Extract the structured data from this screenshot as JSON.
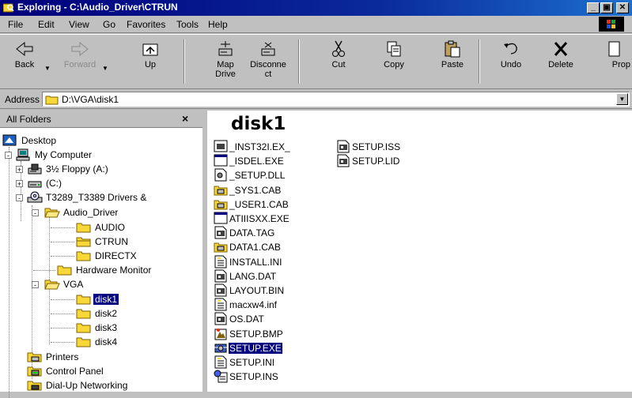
{
  "window": {
    "title": "Exploring - C:\\Audio_Driver\\CTRUN",
    "buttons": [
      "_",
      "🗗",
      "✕"
    ]
  },
  "menu": [
    "File",
    "Edit",
    "View",
    "Go",
    "Favorites",
    "Tools",
    "Help"
  ],
  "toolbar": {
    "back": "Back",
    "forward": "Forward",
    "up": "Up",
    "map_drive_1": "Map",
    "map_drive_2": "Drive",
    "disconnect_1": "Disconne",
    "disconnect_2": "ct",
    "cut": "Cut",
    "copy": "Copy",
    "paste": "Paste",
    "undo": "Undo",
    "delete": "Delete",
    "properties": "Prop"
  },
  "address": {
    "label": "Address",
    "value": "D:\\VGA\\disk1"
  },
  "left_pane": {
    "header": "All Folders",
    "close": "×",
    "tree": [
      {
        "label": "Desktop"
      },
      {
        "label": "My Computer"
      },
      {
        "label": "3½ Floppy (A:)"
      },
      {
        "label": "(C:)"
      },
      {
        "label": "T3289_T3389 Drivers &"
      },
      {
        "label": "Audio_Driver"
      },
      {
        "label": "AUDIO"
      },
      {
        "label": "CTRUN"
      },
      {
        "label": "DIRECTX"
      },
      {
        "label": "Hardware Monitor"
      },
      {
        "label": "VGA"
      },
      {
        "label": "disk1"
      },
      {
        "label": "disk2"
      },
      {
        "label": "disk3"
      },
      {
        "label": "disk4"
      },
      {
        "label": "Printers"
      },
      {
        "label": "Control Panel"
      },
      {
        "label": "Dial-Up Networking"
      }
    ]
  },
  "right_pane": {
    "folder_title": "disk1",
    "files": [
      {
        "name": "_INST32I.EX_"
      },
      {
        "name": "_ISDEL.EXE"
      },
      {
        "name": "_SETUP.DLL"
      },
      {
        "name": "_SYS1.CAB"
      },
      {
        "name": "_USER1.CAB"
      },
      {
        "name": "ATIIISXX.EXE"
      },
      {
        "name": "DATA.TAG"
      },
      {
        "name": "DATA1.CAB"
      },
      {
        "name": "INSTALL.INI"
      },
      {
        "name": "LANG.DAT"
      },
      {
        "name": "LAYOUT.BIN"
      },
      {
        "name": "macxw4.inf"
      },
      {
        "name": "OS.DAT"
      },
      {
        "name": "SETUP.BMP"
      },
      {
        "name": "SETUP.EXE"
      },
      {
        "name": "SETUP.INI"
      },
      {
        "name": "SETUP.INS"
      },
      {
        "name": "SETUP.ISS"
      },
      {
        "name": "SETUP.LID"
      }
    ]
  },
  "colors": {
    "title_gradient_start": "#00007b",
    "title_gradient_end": "#1c6fd0",
    "selection": "#000080",
    "folder_yellow": "#f8d838"
  }
}
